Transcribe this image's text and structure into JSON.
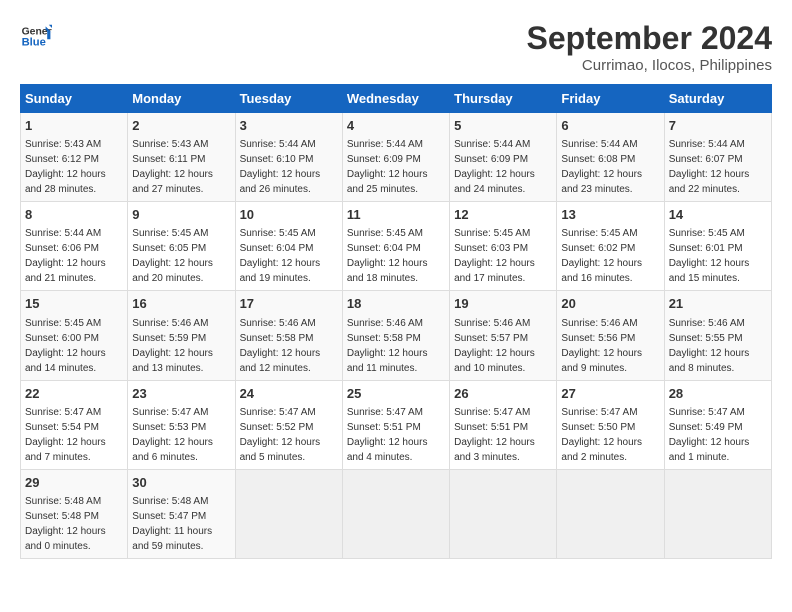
{
  "logo": {
    "line1": "General",
    "line2": "Blue"
  },
  "title": "September 2024",
  "subtitle": "Currimao, Ilocos, Philippines",
  "days_of_week": [
    "Sunday",
    "Monday",
    "Tuesday",
    "Wednesday",
    "Thursday",
    "Friday",
    "Saturday"
  ],
  "weeks": [
    [
      {
        "day": "1",
        "rise": "5:43 AM",
        "set": "6:12 PM",
        "daylight": "12 hours and 28 minutes."
      },
      {
        "day": "2",
        "rise": "5:43 AM",
        "set": "6:11 PM",
        "daylight": "12 hours and 27 minutes."
      },
      {
        "day": "3",
        "rise": "5:44 AM",
        "set": "6:10 PM",
        "daylight": "12 hours and 26 minutes."
      },
      {
        "day": "4",
        "rise": "5:44 AM",
        "set": "6:09 PM",
        "daylight": "12 hours and 25 minutes."
      },
      {
        "day": "5",
        "rise": "5:44 AM",
        "set": "6:09 PM",
        "daylight": "12 hours and 24 minutes."
      },
      {
        "day": "6",
        "rise": "5:44 AM",
        "set": "6:08 PM",
        "daylight": "12 hours and 23 minutes."
      },
      {
        "day": "7",
        "rise": "5:44 AM",
        "set": "6:07 PM",
        "daylight": "12 hours and 22 minutes."
      }
    ],
    [
      {
        "day": "8",
        "rise": "5:44 AM",
        "set": "6:06 PM",
        "daylight": "12 hours and 21 minutes."
      },
      {
        "day": "9",
        "rise": "5:45 AM",
        "set": "6:05 PM",
        "daylight": "12 hours and 20 minutes."
      },
      {
        "day": "10",
        "rise": "5:45 AM",
        "set": "6:04 PM",
        "daylight": "12 hours and 19 minutes."
      },
      {
        "day": "11",
        "rise": "5:45 AM",
        "set": "6:04 PM",
        "daylight": "12 hours and 18 minutes."
      },
      {
        "day": "12",
        "rise": "5:45 AM",
        "set": "6:03 PM",
        "daylight": "12 hours and 17 minutes."
      },
      {
        "day": "13",
        "rise": "5:45 AM",
        "set": "6:02 PM",
        "daylight": "12 hours and 16 minutes."
      },
      {
        "day": "14",
        "rise": "5:45 AM",
        "set": "6:01 PM",
        "daylight": "12 hours and 15 minutes."
      }
    ],
    [
      {
        "day": "15",
        "rise": "5:45 AM",
        "set": "6:00 PM",
        "daylight": "12 hours and 14 minutes."
      },
      {
        "day": "16",
        "rise": "5:46 AM",
        "set": "5:59 PM",
        "daylight": "12 hours and 13 minutes."
      },
      {
        "day": "17",
        "rise": "5:46 AM",
        "set": "5:58 PM",
        "daylight": "12 hours and 12 minutes."
      },
      {
        "day": "18",
        "rise": "5:46 AM",
        "set": "5:58 PM",
        "daylight": "12 hours and 11 minutes."
      },
      {
        "day": "19",
        "rise": "5:46 AM",
        "set": "5:57 PM",
        "daylight": "12 hours and 10 minutes."
      },
      {
        "day": "20",
        "rise": "5:46 AM",
        "set": "5:56 PM",
        "daylight": "12 hours and 9 minutes."
      },
      {
        "day": "21",
        "rise": "5:46 AM",
        "set": "5:55 PM",
        "daylight": "12 hours and 8 minutes."
      }
    ],
    [
      {
        "day": "22",
        "rise": "5:47 AM",
        "set": "5:54 PM",
        "daylight": "12 hours and 7 minutes."
      },
      {
        "day": "23",
        "rise": "5:47 AM",
        "set": "5:53 PM",
        "daylight": "12 hours and 6 minutes."
      },
      {
        "day": "24",
        "rise": "5:47 AM",
        "set": "5:52 PM",
        "daylight": "12 hours and 5 minutes."
      },
      {
        "day": "25",
        "rise": "5:47 AM",
        "set": "5:51 PM",
        "daylight": "12 hours and 4 minutes."
      },
      {
        "day": "26",
        "rise": "5:47 AM",
        "set": "5:51 PM",
        "daylight": "12 hours and 3 minutes."
      },
      {
        "day": "27",
        "rise": "5:47 AM",
        "set": "5:50 PM",
        "daylight": "12 hours and 2 minutes."
      },
      {
        "day": "28",
        "rise": "5:47 AM",
        "set": "5:49 PM",
        "daylight": "12 hours and 1 minute."
      }
    ],
    [
      {
        "day": "29",
        "rise": "5:48 AM",
        "set": "5:48 PM",
        "daylight": "12 hours and 0 minutes."
      },
      {
        "day": "30",
        "rise": "5:48 AM",
        "set": "5:47 PM",
        "daylight": "11 hours and 59 minutes."
      },
      null,
      null,
      null,
      null,
      null
    ]
  ],
  "labels": {
    "sunrise": "Sunrise:",
    "sunset": "Sunset:",
    "daylight": "Daylight:"
  }
}
